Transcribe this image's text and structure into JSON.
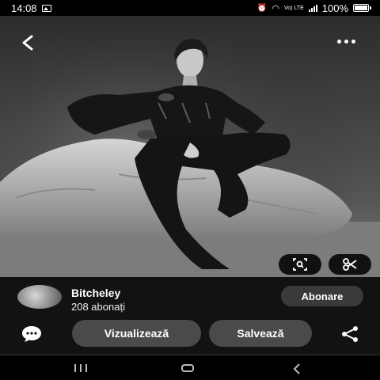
{
  "status": {
    "time": "14:08",
    "network": "Vo) LTE",
    "battery": "100%"
  },
  "photo": {
    "description_icons": [
      "back-icon",
      "more-icon",
      "visual-search-icon",
      "scissors-icon"
    ]
  },
  "pin": {
    "username": "Bitcheley",
    "subscribers": "208 abonați",
    "follow_label": "Abonare",
    "view_label": "Vizualizează",
    "save_label": "Salvează"
  },
  "nav": {
    "icons": [
      "recents-icon",
      "home-icon",
      "back-nav-icon"
    ]
  },
  "colors": {
    "background": "#000000",
    "panel": "#121212",
    "button": "#4a4a4a",
    "follow_button": "#3a3a3a"
  }
}
